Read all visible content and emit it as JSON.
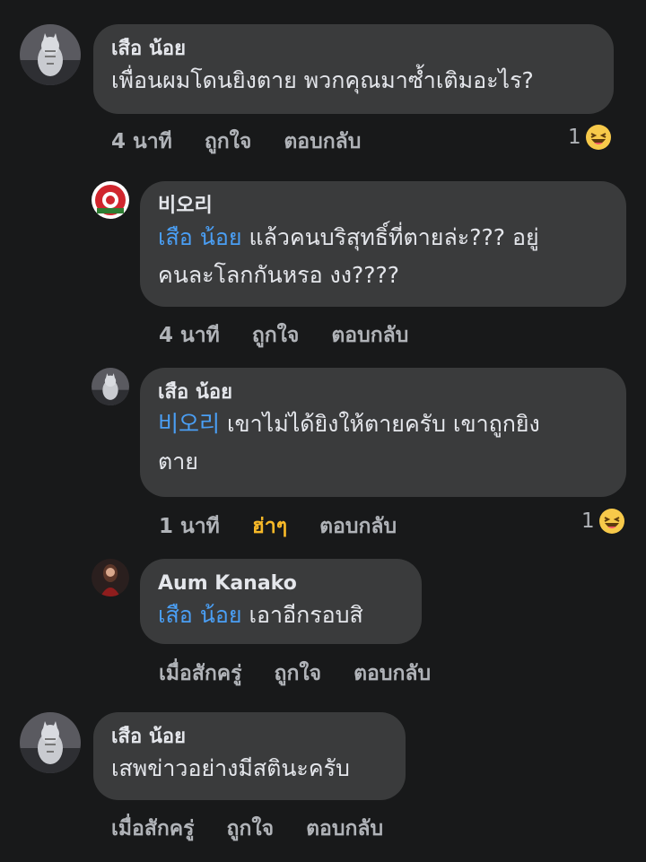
{
  "comments": [
    {
      "author": "เสือ น้อย",
      "text": "เพื่อนผมโดนยิงตาย พวกคุณมาซ้ำเติมอะไร?",
      "time": "4 นาที",
      "like": "ถูกใจ",
      "reply": "ตอบกลับ",
      "reaction_count": "1"
    },
    {
      "author": "비오리",
      "mention": "เสือ น้อย",
      "text_line1": " แล้วคนบริสุทธิ์ที่ตายล่ะ??? อยู่",
      "text_line2": "คนละโลกกันหรอ งง????",
      "time": "4 นาที",
      "like": "ถูกใจ",
      "reply": "ตอบกลับ"
    },
    {
      "author": "เสือ น้อย",
      "mention": "비오리",
      "text_line1": " เขาไม่ได้ยิงให้ตายครับ เขาถูกยิง",
      "text_line2": "ตาย",
      "time": "1 นาที",
      "like": "ฮ่าๆ",
      "reply": "ตอบกลับ",
      "reaction_count": "1"
    },
    {
      "author": "Aum Kanako",
      "mention": "เสือ น้อย",
      "text_line1": " เอาอีกรอบสิ",
      "time": "เมื่อสักครู่",
      "like": "ถูกใจ",
      "reply": "ตอบกลับ"
    },
    {
      "author": "เสือ น้อย",
      "text": "เสพข่าวอย่างมีสตินะครับ",
      "time": "เมื่อสักครู่",
      "like": "ถูกใจ",
      "reply": "ตอบกลับ"
    }
  ],
  "colors": {
    "background": "#18191a",
    "bubble": "#3a3b3c",
    "mention": "#4a9ff5",
    "muted": "#b0b3b8",
    "haha": "#f7b928"
  },
  "icons": {
    "cat_avatar": "cat-avatar-icon",
    "red_avatar": "red-logo-avatar-icon",
    "woman_avatar": "woman-avatar-icon",
    "haha_emoji": "laughing-emoji-icon"
  }
}
